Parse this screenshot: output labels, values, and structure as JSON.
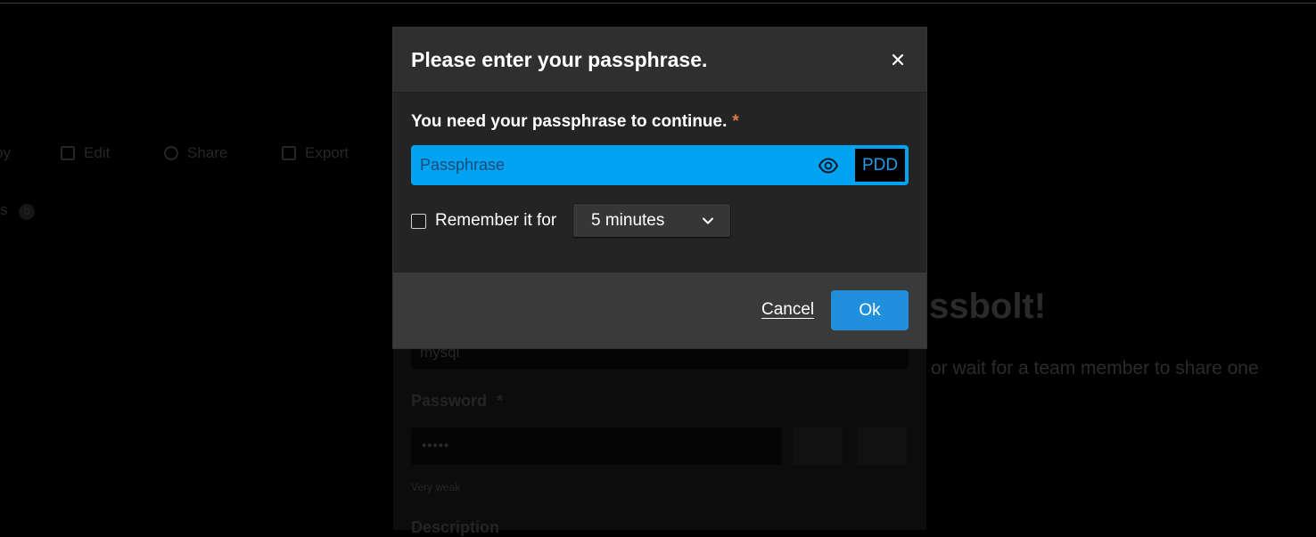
{
  "background": {
    "toolbar": [
      {
        "label": "py",
        "icon": "copy-icon"
      },
      {
        "label": "Edit",
        "icon": "edit-icon"
      },
      {
        "label": "Share",
        "icon": "share-icon"
      },
      {
        "label": "Export",
        "icon": "export-icon"
      }
    ],
    "tab_label": "s",
    "tab_count": "0",
    "welcome_fragment": "ssbolt!",
    "subtitle_fragment": "or wait for a team member to share one",
    "form": {
      "name_value": "mysql",
      "password_label": "Password",
      "password_required": "*",
      "password_value": "•••••",
      "strength": "Very weak",
      "description_label": "Description"
    }
  },
  "dialog": {
    "title": "Please enter your passphrase.",
    "close_icon": "close-icon",
    "field_label": "You need your passphrase to continue.",
    "required_mark": "*",
    "passphrase_placeholder": "Passphrase",
    "passphrase_value": "",
    "reveal_icon": "eye-icon",
    "security_token": "PDD",
    "remember_label": "Remember it for",
    "remember_checked": false,
    "remember_duration": "5 minutes",
    "cancel_label": "Cancel",
    "ok_label": "Ok"
  },
  "colors": {
    "input_background": "#00a3f2",
    "primary_button": "#2190dc",
    "required": "#e07a3e",
    "token_text": "#1e9be9"
  }
}
